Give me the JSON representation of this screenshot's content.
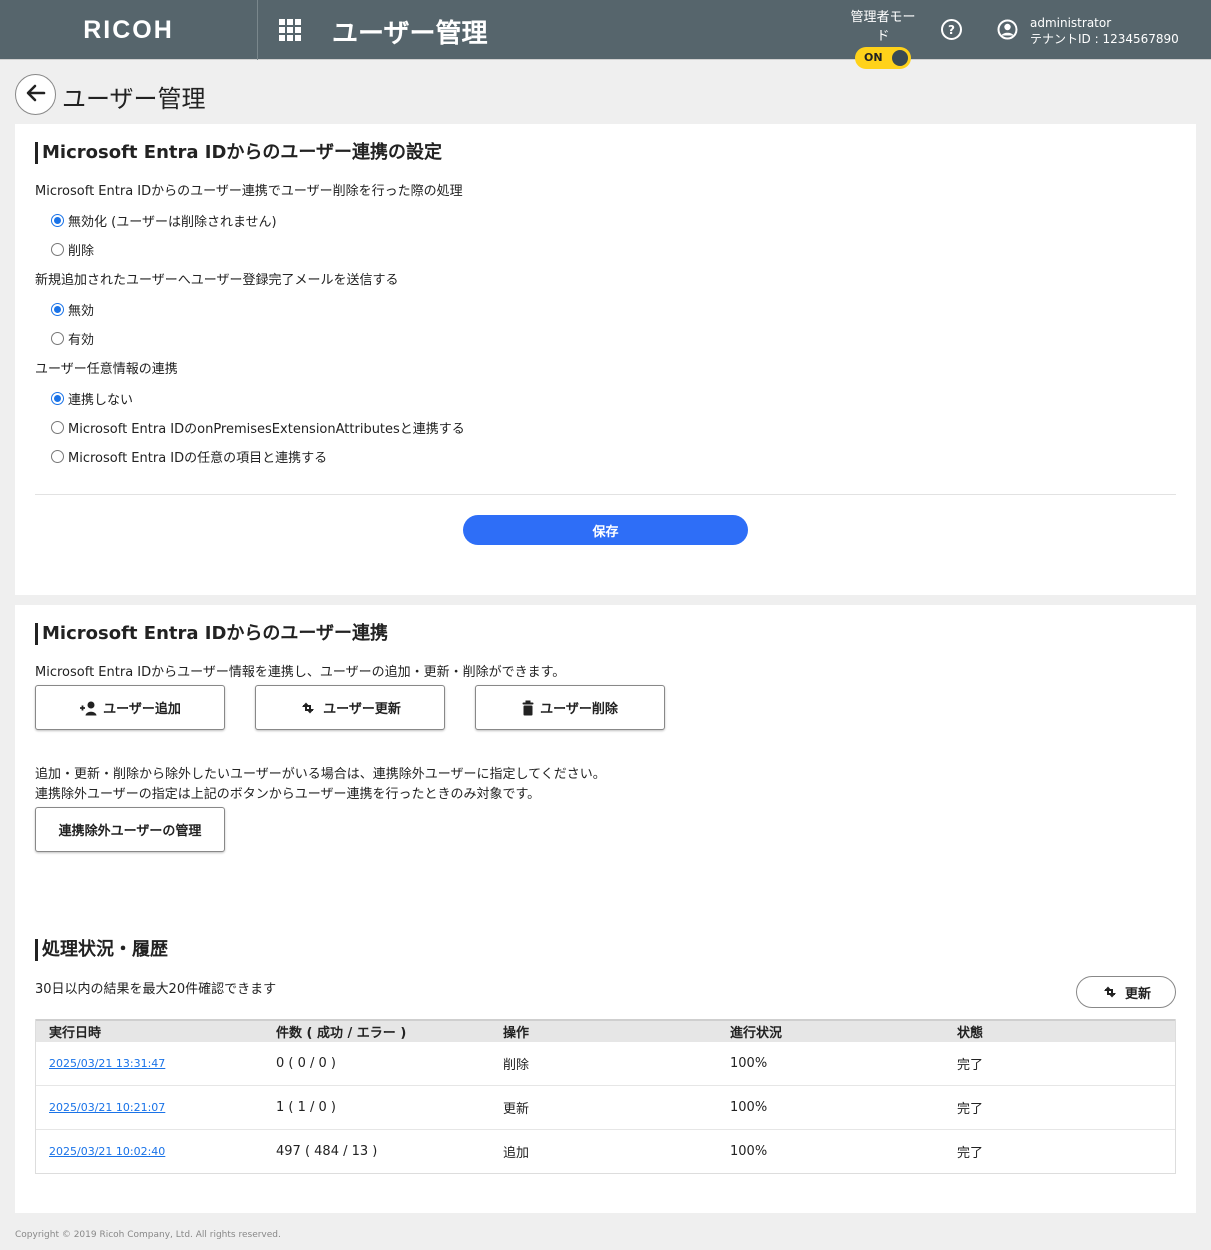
{
  "header": {
    "logo": "RICOH",
    "title": "ユーザー管理",
    "admin_mode_label": "管理者モード",
    "admin_mode_toggle": "ON",
    "username": "administrator",
    "tenant": "テナントID : 1234567890"
  },
  "page": {
    "title": "ユーザー管理"
  },
  "settings": {
    "title": "Microsoft Entra IDからのユーザー連携の設定",
    "q1": "Microsoft Entra IDからのユーザー連携でユーザー削除を行った際の処理",
    "q1_options": [
      "無効化 (ユーザーは削除されません)",
      "削除"
    ],
    "q2": "新規追加されたユーザーへユーザー登録完了メールを送信する",
    "q2_options": [
      "無効",
      "有効"
    ],
    "q3": "ユーザー任意情報の連携",
    "q3_options": [
      "連携しない",
      "Microsoft Entra IDのonPremisesExtensionAttributesと連携する",
      "Microsoft Entra IDの任意の項目と連携する"
    ],
    "save_label": "保存"
  },
  "sync": {
    "title": "Microsoft Entra IDからのユーザー連携",
    "description": "Microsoft Entra IDからユーザー情報を連携し、ユーザーの追加・更新・削除ができます。",
    "add_label": "ユーザー追加",
    "update_label": "ユーザー更新",
    "delete_label": "ユーザー削除",
    "note1": "追加・更新・削除から除外したいユーザーがいる場合は、連携除外ユーザーに指定してください。",
    "note2": "連携除外ユーザーの指定は上記のボタンからユーザー連携を行ったときのみ対象です。",
    "exclude_label": "連携除外ユーザーの管理"
  },
  "history": {
    "title": "処理状況・履歴",
    "description": "30日以内の結果を最大20件確認できます",
    "refresh_label": "更新",
    "columns": [
      "実行日時",
      "件数 ( 成功 / エラー )",
      "操作",
      "進行状況",
      "状態"
    ],
    "rows": [
      {
        "date": "2025/03/21 13:31:47",
        "count": "0 ( 0 / 0 )",
        "op": "削除",
        "progress": "100%",
        "status": "完了"
      },
      {
        "date": "2025/03/21 10:21:07",
        "count": "1 ( 1 / 0 )",
        "op": "更新",
        "progress": "100%",
        "status": "完了"
      },
      {
        "date": "2025/03/21 10:02:40",
        "count": "497 ( 484 / 13 )",
        "op": "追加",
        "progress": "100%",
        "status": "完了"
      }
    ]
  },
  "footer": {
    "copyright": "Copyright © 2019 Ricoh Company, Ltd. All rights reserved."
  },
  "colors": {
    "header_bg": "#56656c",
    "accent_blue": "#2e6ef7",
    "toggle_yellow": "#ffd21a"
  },
  "icons": [
    "apps-grid-icon",
    "help-icon",
    "user-circle-icon",
    "back-arrow-icon",
    "add-user-icon",
    "sync-icon",
    "trash-icon",
    "refresh-icon"
  ]
}
